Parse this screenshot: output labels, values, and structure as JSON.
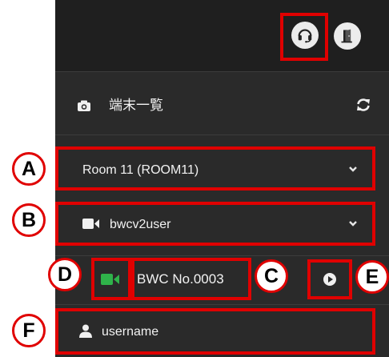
{
  "header": {
    "support_icon": "headset-icon",
    "exit_icon": "exit-door-icon"
  },
  "device_list": {
    "title": "端末一覧",
    "camera_icon": "camera-icon",
    "refresh_icon": "refresh-icon"
  },
  "room_select": {
    "value": "Room 11 (ROOM11)"
  },
  "user_select": {
    "value": "bwcv2user"
  },
  "device": {
    "name": "BWC No.0003"
  },
  "login_user": {
    "name": "username"
  },
  "annotations": {
    "a": "A",
    "b": "B",
    "c": "C",
    "d": "D",
    "e": "E",
    "f": "F"
  },
  "colors": {
    "panel": "#2a2a2a",
    "topbar": "#1f1f1f",
    "annotation": "#e00000",
    "video_active": "#2fb34a"
  }
}
